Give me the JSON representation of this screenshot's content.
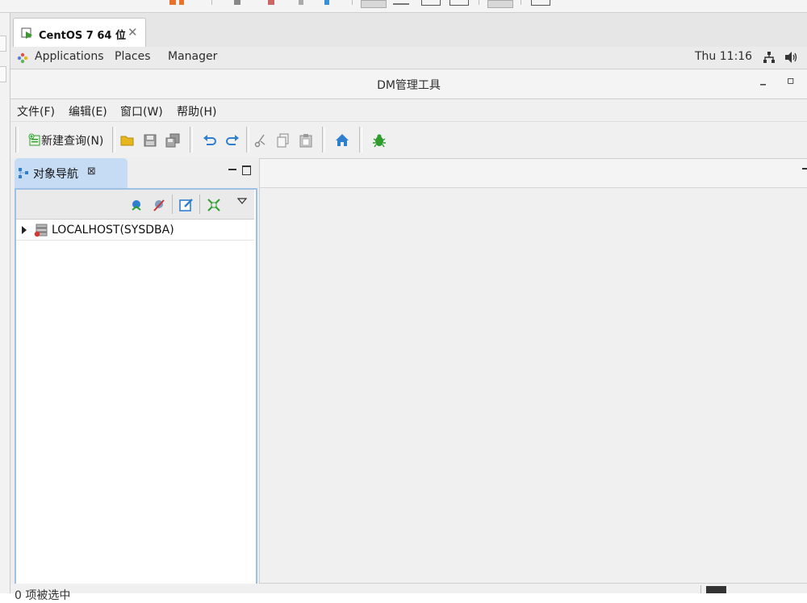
{
  "vm_tab": {
    "label": "CentOS 7 64 位",
    "close": "✕"
  },
  "gnome_bar": {
    "applications": "Applications",
    "places": "Places",
    "manager": "Manager",
    "clock": "Thu 11:16"
  },
  "window": {
    "title": "DM管理工具",
    "minimize": "_",
    "maximize": "▫"
  },
  "menu": {
    "file": "文件(F)",
    "edit": "编辑(E)",
    "window": "窗口(W)",
    "help": "帮助(H)"
  },
  "toolbar": {
    "new_query": "新建查询(N)"
  },
  "navigator": {
    "tab_label": "对象导航",
    "tab_close": "⊠",
    "tree": [
      {
        "label": "LOCALHOST(SYSDBA)"
      }
    ]
  },
  "status": {
    "text": "0 项被选中"
  },
  "colors": {
    "accent": "#2f7fd0",
    "nav_tab": "#c6dcf5",
    "panel_border": "#9ec0e4",
    "bug_green": "#2e9d2e",
    "folder_yellow": "#e6b61c"
  },
  "icons": [
    "play-icon",
    "network-icon",
    "volume-icon",
    "new-query-icon",
    "open-folder-icon",
    "save-icon",
    "save-all-icon",
    "undo-icon",
    "redo-icon",
    "cut-icon",
    "copy-icon",
    "paste-icon",
    "home-icon",
    "bug-icon",
    "connect-icon",
    "disconnect-icon",
    "edit-icon",
    "collapse-all-icon",
    "view-menu-icon",
    "database-icon"
  ]
}
